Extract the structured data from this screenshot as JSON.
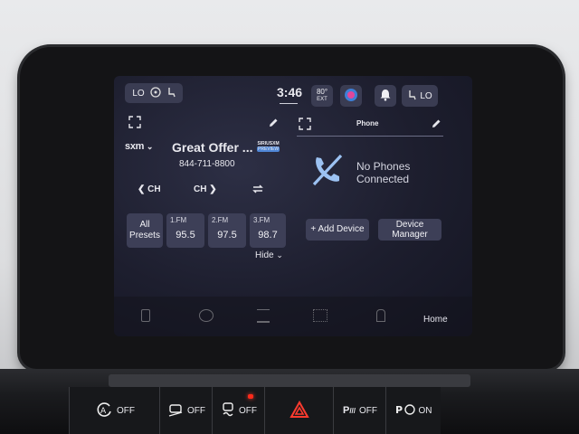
{
  "status_bar": {
    "left_seat_label": "LO",
    "time": "3:46",
    "temperature": "80°",
    "temperature_sub": "EXT",
    "right_seat_label": "LO"
  },
  "radio_panel": {
    "source": "sxm",
    "station_title": "Great Offer ...",
    "badge_top": "SIRIUSXM",
    "badge_bottom": "PREVIEW",
    "phone_number": "844-711-8800",
    "ch_down_label": "CH",
    "ch_up_label": "CH",
    "all_presets_line1": "All",
    "all_presets_line2": "Presets",
    "presets": [
      {
        "label": "1.FM",
        "freq": "95.5"
      },
      {
        "label": "2.FM",
        "freq": "97.5"
      },
      {
        "label": "3.FM",
        "freq": "98.7"
      }
    ],
    "hide_label": "Hide"
  },
  "phone_panel": {
    "title": "Phone",
    "status_line1": "No Phones",
    "status_line2": "Connected",
    "add_device_label": "+ Add Device",
    "device_manager_line1": "Device",
    "device_manager_line2": "Manager"
  },
  "dock": {
    "home_label": "Home"
  },
  "hardware_switches": {
    "auto_start_stop": "OFF",
    "hill_descent": "OFF",
    "traction": "OFF",
    "park_assist": "OFF",
    "lane_assist": "ON"
  },
  "colors": {
    "accent_blue": "#4f86d6",
    "hazard_red": "#ff2a1a",
    "button_bg": "#3d3f57"
  }
}
